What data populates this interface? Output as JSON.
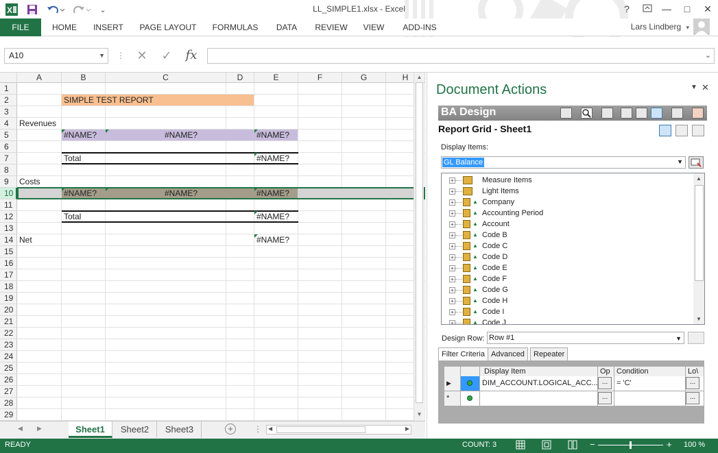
{
  "window": {
    "title": "LL_SIMPLE1.xlsx - Excel",
    "help": "?",
    "user": "Lars Lindberg"
  },
  "ribbon": {
    "tabs": [
      "FILE",
      "HOME",
      "INSERT",
      "PAGE LAYOUT",
      "FORMULAS",
      "DATA",
      "REVIEW",
      "VIEW",
      "ADD-INS"
    ]
  },
  "formula_bar": {
    "name_box": "A10",
    "formula": "",
    "fx": "fx"
  },
  "sheet": {
    "columns": [
      "A",
      "B",
      "C",
      "D",
      "E",
      "F",
      "G",
      "H"
    ],
    "rows": [
      "1",
      "2",
      "3",
      "4",
      "5",
      "6",
      "7",
      "8",
      "9",
      "10",
      "11",
      "12",
      "13",
      "14",
      "15",
      "16",
      "17",
      "18",
      "19",
      "20",
      "21",
      "22",
      "23",
      "24",
      "25",
      "26",
      "27",
      "28",
      "29"
    ],
    "cells": {
      "B2": "SIMPLE TEST REPORT",
      "A4": "Revenues",
      "B5": "#NAME?",
      "C5": "#NAME?",
      "E5": "#NAME?",
      "B7": "Total",
      "E7": "#NAME?",
      "A9": "Costs",
      "B10": "#NAME?",
      "C10": "#NAME?",
      "E10": "#NAME?",
      "B12": "Total",
      "E12": "#NAME?",
      "A14": "Net",
      "E14": "#NAME?"
    },
    "tabs": [
      "Sheet1",
      "Sheet2",
      "Sheet3"
    ],
    "active_tab": "Sheet1",
    "colors": {
      "title_fill": "#f8c090",
      "revenue_fill": "#c8bcdc",
      "cost_fill": "#a39d8a",
      "accent": "#217346"
    }
  },
  "status": {
    "mode": "READY",
    "count": "COUNT: 3",
    "zoom": "100 %"
  },
  "pane": {
    "title": "Document Actions",
    "ba_header": "BA Design",
    "report_grid_title": "Report Grid - Sheet1",
    "display_items_label": "Display Items:",
    "display_items_value": "GL Balance",
    "tree_items": [
      "Measure Items",
      "Light Items",
      "Company",
      "Accounting Period",
      "Account",
      "Code B",
      "Code C",
      "Code D",
      "Code E",
      "Code F",
      "Code G",
      "Code H",
      "Code I",
      "Code J"
    ],
    "design_row_label": "Design Row:",
    "design_row_value": "Row #1",
    "filter_tabs": [
      "Filter Criteria",
      "Advanced",
      "Repeater"
    ],
    "filter_grid": {
      "headers": [
        "Display Item",
        "Op",
        "Condition",
        "Lo\\"
      ],
      "rows": [
        {
          "display_item": "DIM_ACCOUNT.LOGICAL_ACC...",
          "op": "...",
          "condition": "= 'C'",
          "lo": "..."
        },
        {
          "display_item": "",
          "op": "...",
          "condition": "",
          "lo": "..."
        }
      ]
    }
  }
}
